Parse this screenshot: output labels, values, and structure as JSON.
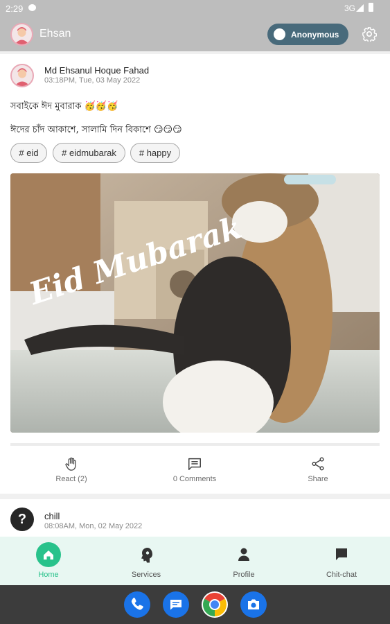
{
  "status_bar": {
    "time": "2:29",
    "network": "3G"
  },
  "app_bar": {
    "user_name": "Ehsan",
    "anonymous_label": "Anonymous"
  },
  "post": {
    "author": "Md Ehsanul Hoque Fahad",
    "timestamp": "03:18PM, Tue, 03 May 2022",
    "line1": "সবাইকে ঈদ মুবারাক 🥳🥳🥳",
    "line2": "ঈদের চাঁদ আকাশে, সালামি দিন বিকাশে 😏😏😏",
    "tags": [
      "# eid",
      "# eidmubarak",
      "# happy"
    ],
    "image_overlay_text": "Eid Mubarak",
    "actions": {
      "react": "React (2)",
      "comments": "0 Comments",
      "share": "Share"
    }
  },
  "post2": {
    "name": "chill",
    "timestamp": "08:08AM, Mon, 02 May 2022"
  },
  "bottom_nav": {
    "items": [
      {
        "label": "Home",
        "icon": "home-icon",
        "active": true
      },
      {
        "label": "Services",
        "icon": "services-icon",
        "active": false
      },
      {
        "label": "Profile",
        "icon": "person-icon",
        "active": false
      },
      {
        "label": "Chit-chat",
        "icon": "chat-icon",
        "active": false
      }
    ]
  },
  "dock": [
    "phone-icon",
    "messages-icon",
    "chrome-icon",
    "camera-icon"
  ],
  "colors": {
    "accent": "#28c28b",
    "toggle": "#486a7b",
    "appbar": "#bdbdbd",
    "nav_bg": "#e8f7f2"
  }
}
